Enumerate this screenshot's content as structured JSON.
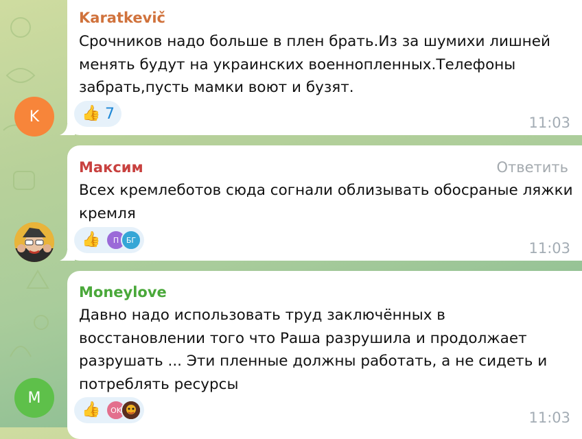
{
  "messages": [
    {
      "sender": "Karatkevič",
      "sender_color": "#d0723c",
      "avatar_letter": "K",
      "avatar_color": "#f7853a",
      "lines": [
        "Срочников надо больше в плен брать.Из за шумихи лишней",
        "менять будут на украинских военнопленных.Телефоны",
        "забрать,пусть мамки воют и бузят."
      ],
      "reaction_emoji": "👍",
      "reaction_count": "7",
      "time": "11:03"
    },
    {
      "sender": "Максим",
      "sender_color": "#c8413f",
      "reply_label": "Ответить",
      "lines": [
        "Всех кремлеботов сюда согнали облизывать обосраные ляжки",
        "кремля"
      ],
      "reaction_emoji": "👍",
      "reactors": [
        {
          "letter": "П",
          "color": "#9b6ad8"
        },
        {
          "letter": "БГ",
          "color": "#35a6d6"
        }
      ],
      "time": "11:03"
    },
    {
      "sender": "Moneylove",
      "sender_color": "#4aa83a",
      "avatar_letter": "M",
      "avatar_color": "#5ec04a",
      "lines": [
        "Давно надо использовать труд заключённых в",
        "восстановлении того что Раша разрушила и продолжает",
        "разрушать ... Эти пленные должны работать, а не сидеть и",
        "потреблять ресурсы"
      ],
      "reaction_emoji": "👍",
      "reactors": [
        {
          "letter": "OK",
          "color": "#e36f8d"
        }
      ],
      "time": "11:03"
    }
  ]
}
